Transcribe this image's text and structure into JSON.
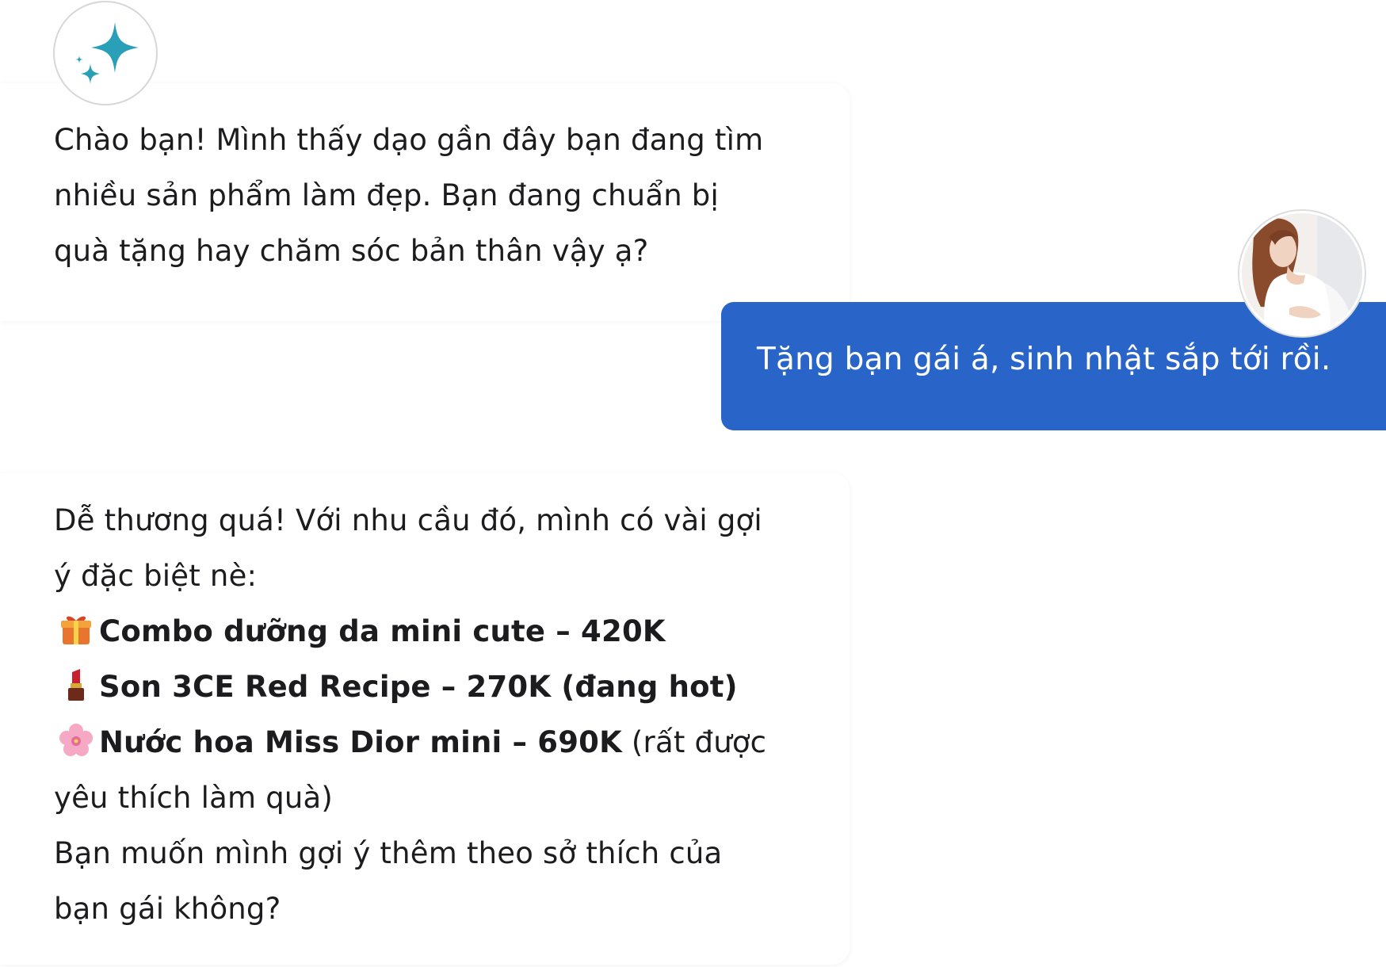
{
  "assistant": {
    "avatar_icon": "sparkle-icon",
    "greeting": {
      "lines": [
        "Chào bạn! Mình thấy dạo gần đây bạn đang tìm",
        "nhiều sản phẩm làm đẹp. Bạn đang chuẩn bị",
        "quà tặng hay chăm sóc bản thân vậy ạ?"
      ]
    },
    "reply": {
      "intro_lines": [
        "Dễ thương quá! Với nhu cầu đó, mình có vài gợi",
        "ý đặc biệt nè:"
      ],
      "products": [
        {
          "icon": "gift-icon",
          "text": "Combo dưỡng da mini cute – 420K",
          "note": ""
        },
        {
          "icon": "lipstick-icon",
          "text": "Son 3CE Red Recipe – 270K (đang hot)",
          "note": ""
        },
        {
          "icon": "cherry-blossom-icon",
          "text": "Nước hoa Miss Dior mini – 690K",
          "note": " (rất được"
        }
      ],
      "continuation": "yêu thích làm quà)",
      "outro_lines": [
        "Bạn muốn mình gợi ý thêm theo sở thích của",
        "bạn gái không?"
      ]
    }
  },
  "user": {
    "avatar_icon": "user-photo-avatar",
    "message": "Tặng bạn gái á, sinh nhật sắp tới rồi."
  },
  "colors": {
    "user_bubble": "#2965c9",
    "sparkle": "#2a9fb8"
  }
}
